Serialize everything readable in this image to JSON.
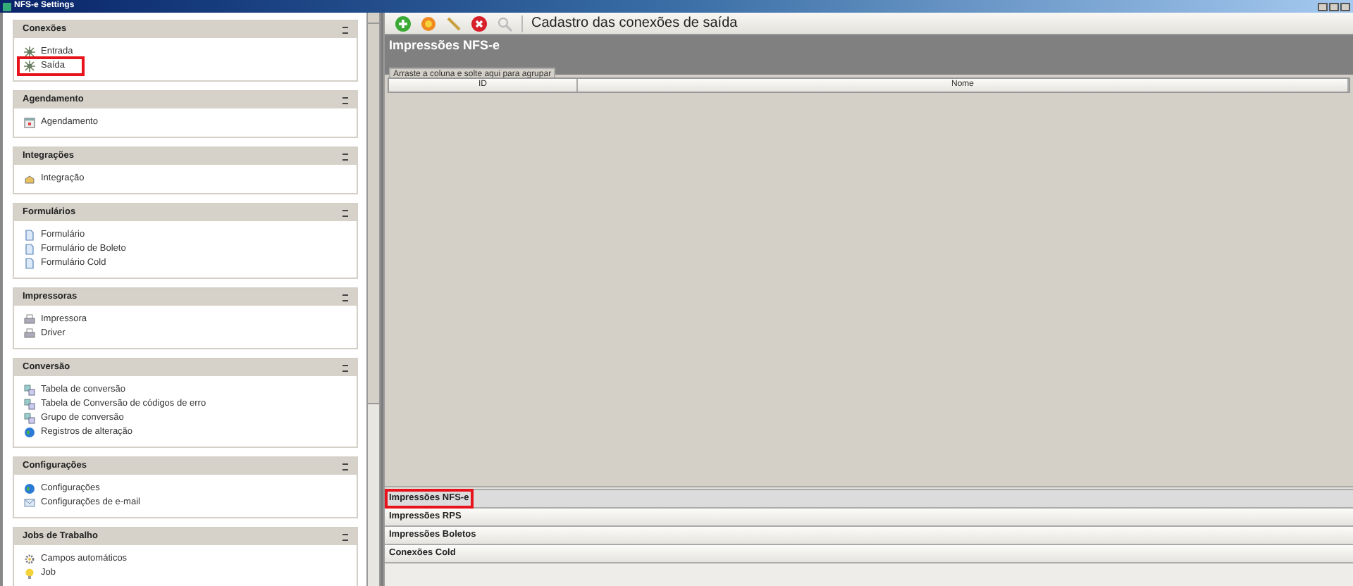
{
  "window": {
    "title": "NFS-e Settings"
  },
  "sidebar": {
    "sections": [
      {
        "title": "Conexões",
        "items": [
          {
            "label": "Entrada",
            "kind": "connect",
            "highlighted": false
          },
          {
            "label": "Saída",
            "kind": "connect",
            "highlighted": true
          }
        ]
      },
      {
        "title": "Agendamento",
        "items": [
          {
            "label": "Agendamento",
            "kind": "calendar",
            "highlighted": false
          }
        ]
      },
      {
        "title": "Integrações",
        "items": [
          {
            "label": "Integração",
            "kind": "integration",
            "highlighted": false
          }
        ]
      },
      {
        "title": "Formulários",
        "items": [
          {
            "label": "Formulário",
            "kind": "document",
            "highlighted": false
          },
          {
            "label": "Formulário de Boleto",
            "kind": "document",
            "highlighted": false
          },
          {
            "label": "Formulário Cold",
            "kind": "document",
            "highlighted": false
          }
        ]
      },
      {
        "title": "Impressoras",
        "items": [
          {
            "label": "Impressora",
            "kind": "printer",
            "highlighted": false
          },
          {
            "label": "Driver",
            "kind": "printer",
            "highlighted": false
          }
        ]
      },
      {
        "title": "Conversão",
        "items": [
          {
            "label": "Tabela de conversão",
            "kind": "table",
            "highlighted": false
          },
          {
            "label": "Tabela de Conversão de códigos de erro",
            "kind": "table",
            "highlighted": false
          },
          {
            "label": "Grupo de conversão",
            "kind": "table",
            "highlighted": false
          },
          {
            "label": "Registros de alteração",
            "kind": "globe",
            "highlighted": false
          }
        ]
      },
      {
        "title": "Configurações",
        "items": [
          {
            "label": "Configurações",
            "kind": "globe",
            "highlighted": false
          },
          {
            "label": "Configurações de e-mail",
            "kind": "mail",
            "highlighted": false
          }
        ]
      },
      {
        "title": "Jobs de Trabalho",
        "items": [
          {
            "label": "Campos automáticos",
            "kind": "gear",
            "highlighted": false
          },
          {
            "label": "Job",
            "kind": "bulb",
            "highlighted": false
          }
        ]
      }
    ]
  },
  "toolbar": {
    "title": "Cadastro das conexões de saída"
  },
  "grid": {
    "title": "Impressões NFS-e",
    "group_panel": "Arraste a coluna e solte aqui para agrupar",
    "columns": [
      "ID",
      "Nome"
    ]
  },
  "nav_bars": [
    {
      "label": "Impressões NFS-e",
      "selected": true,
      "highlighted": true
    },
    {
      "label": "Impressões RPS",
      "selected": false,
      "highlighted": false
    },
    {
      "label": "Impressões Boletos",
      "selected": false,
      "highlighted": false
    },
    {
      "label": "Conexões Cold",
      "selected": false,
      "highlighted": false
    }
  ]
}
